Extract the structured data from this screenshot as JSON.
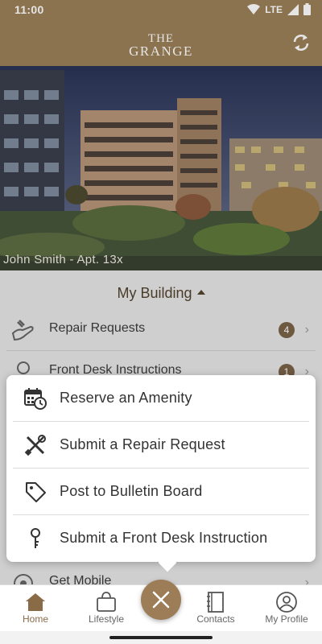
{
  "status_bar": {
    "time": "11:00",
    "network": "LTE"
  },
  "header": {
    "logo_line1": "THE",
    "logo_line2": "GRANGE",
    "refresh_icon": "refresh-icon"
  },
  "hero": {
    "resident": "John Smith - Apt. 13x"
  },
  "section": {
    "title": "My Building",
    "items": [
      {
        "label": "Repair Requests",
        "badge": "4",
        "icon": "wrench-hand-icon"
      },
      {
        "label": "Front Desk Instructions",
        "badge": "1",
        "icon": "person-icon"
      },
      {
        "label": "",
        "icon": "calendar-icon"
      },
      {
        "label": "",
        "icon": "clipboard-icon"
      },
      {
        "label": "",
        "icon": "person-icon"
      },
      {
        "label": "Get Mobile",
        "icon": "location-icon"
      }
    ]
  },
  "menu": {
    "items": [
      {
        "label": "Reserve an Amenity",
        "icon": "calendar-clock-icon"
      },
      {
        "label": "Submit a Repair Request",
        "icon": "tools-icon"
      },
      {
        "label": "Post to Bulletin Board",
        "icon": "tag-icon"
      },
      {
        "label": "Submit a Front Desk Instruction",
        "icon": "key-icon"
      }
    ]
  },
  "bottom_nav": {
    "items": [
      {
        "label": "Home",
        "icon": "home-icon",
        "active": true
      },
      {
        "label": "Lifestyle",
        "icon": "shopping-bag-icon"
      },
      {
        "label": "Contacts",
        "icon": "address-book-icon"
      },
      {
        "label": "My Profile",
        "icon": "profile-icon"
      }
    ],
    "fab_icon": "close-icon"
  },
  "colors": {
    "brand": "#9c8059",
    "accent_dark": "#53432f",
    "badge": "#7a6248"
  }
}
